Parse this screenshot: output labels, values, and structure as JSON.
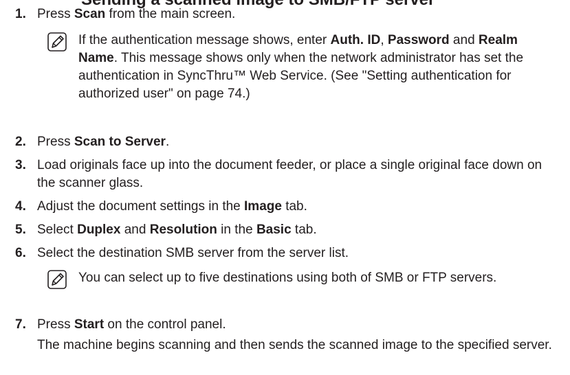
{
  "heading": "Sending a scanned image to SMB/FTP server",
  "steps": {
    "s1": {
      "num": "1.",
      "pre": "Press ",
      "b1": "Scan",
      "post": " from the main screen."
    },
    "note1": {
      "p1": "If the authentication message shows, enter ",
      "b1": "Auth. ID",
      "p2": ", ",
      "b2": "Password",
      "p3": " and ",
      "b3": "Realm Name",
      "p4": ". This message shows only when the network administrator has set the authentication in SyncThru™ Web Service. (See \"Setting authentication for authorized user\" on page 74.)"
    },
    "s2": {
      "num": "2.",
      "pre": "Press ",
      "b1": "Scan to Server",
      "post": "."
    },
    "s3": {
      "num": "3.",
      "text": "Load originals face up into the document feeder, or place a single original face down on the scanner glass."
    },
    "s4": {
      "num": "4.",
      "pre": "Adjust the document settings in the ",
      "b1": "Image",
      "post": " tab."
    },
    "s5": {
      "num": "5.",
      "pre": "Select ",
      "b1": "Duplex",
      "mid1": " and ",
      "b2": "Resolution",
      "mid2": " in the ",
      "b3": "Basic",
      "post": " tab."
    },
    "s6": {
      "num": "6.",
      "text": "Select the destination SMB server from the server list."
    },
    "note2": {
      "text": "You can select up to five destinations using both of SMB or FTP servers."
    },
    "s7": {
      "num": "7.",
      "pre": "Press ",
      "b1": "Start",
      "post": " on the control panel."
    },
    "s7_detail": {
      "text": "The machine begins scanning and then sends the scanned image to the specified server."
    }
  }
}
